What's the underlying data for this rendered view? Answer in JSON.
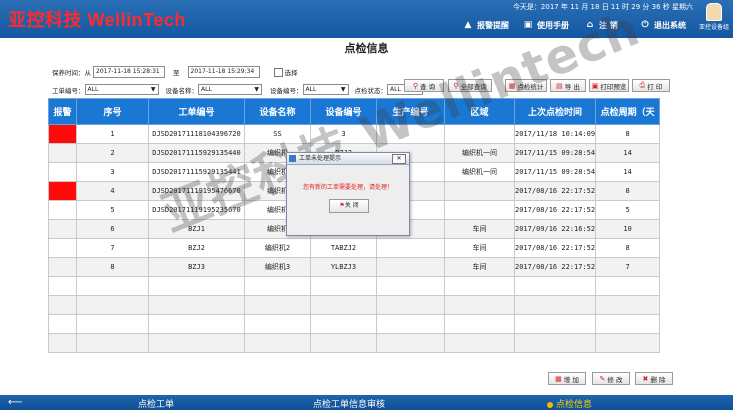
{
  "header": {
    "logo_text": "亚控科技 WellinTech",
    "datetime": "今天是：2017 年 11 月 18 日 11 时 29 分 36 秒   星期六",
    "nav": [
      {
        "label": "报警提醒",
        "icon": "bell-icon"
      },
      {
        "label": "使用手册",
        "icon": "book-icon"
      },
      {
        "label": "注 销",
        "icon": "home-icon"
      },
      {
        "label": "退出系统",
        "icon": "power-icon"
      }
    ],
    "user_label": "亚控设备组"
  },
  "page": {
    "title": "点检信息"
  },
  "filters": {
    "time_label": "保养时间：从",
    "time_from": "2017-11-18 15:28:31",
    "time_to_label": "至",
    "time_to": "2017-11-18 15:29:34",
    "select_label": "选择",
    "work_no_label": "工单编号：",
    "work_no_value": "ALL",
    "device_name_label": "设备名称：",
    "device_name_value": "ALL",
    "device_no_label": "设备编号：",
    "device_no_value": "ALL",
    "check_status_label": "点检状态：",
    "check_status_value": "ALL"
  },
  "toolbar": {
    "query": "查 询",
    "query_all": "全部查询",
    "stats": "点检统计",
    "export": "导 出",
    "print_preview": "打印预览",
    "print": "打 印"
  },
  "table": {
    "columns": [
      "报警",
      "序号",
      "工单编号",
      "设备名称",
      "设备编号",
      "生产编号",
      "区域",
      "上次点检时间",
      "点检周期（天"
    ],
    "rows": [
      {
        "alarm": true,
        "no": "1",
        "work_no": "DJSD20171118104396720",
        "device_name": "SS",
        "device_no": "3",
        "prod_no": "",
        "area": "",
        "last_time": "2017/11/18 10:14:09",
        "cycle": "8"
      },
      {
        "alarm": false,
        "no": "2",
        "work_no": "DJSD20171115929135440",
        "device_name": "编织机",
        "device_no": "BZJ2",
        "prod_no": "",
        "area": "编织机一间",
        "last_time": "2017/11/15 09:28:54",
        "cycle": "14"
      },
      {
        "alarm": false,
        "no": "3",
        "work_no": "DJSD20171115929135441",
        "device_name": "编织机",
        "device_no": "",
        "prod_no": "",
        "area": "编织机一间",
        "last_time": "2017/11/15 09:28:54",
        "cycle": "14"
      },
      {
        "alarm": true,
        "no": "4",
        "work_no": "DJSD20171119195476670",
        "device_name": "编织机",
        "device_no": "",
        "prod_no": "",
        "area": "",
        "last_time": "2017/08/16 22:17:52",
        "cycle": "8"
      },
      {
        "alarm": false,
        "no": "5",
        "work_no": "DJSD20171119195235670",
        "device_name": "编织机",
        "device_no": "",
        "prod_no": "",
        "area": "",
        "last_time": "2017/08/16 22:17:52",
        "cycle": "5"
      },
      {
        "alarm": false,
        "no": "6",
        "work_no": "BZJ1",
        "device_name": "编织机",
        "device_no": "",
        "prod_no": "",
        "area": "车间",
        "last_time": "2017/09/16 22:16:52",
        "cycle": "10"
      },
      {
        "alarm": false,
        "no": "7",
        "work_no": "BZJ2",
        "device_name": "编织机2",
        "device_no": "TABZJ2",
        "prod_no": "",
        "area": "车间",
        "last_time": "2017/08/16 22:17:52",
        "cycle": "8"
      },
      {
        "alarm": false,
        "no": "8",
        "work_no": "BZJ3",
        "device_name": "编织机3",
        "device_no": "YLBZJ3",
        "prod_no": "",
        "area": "车间",
        "last_time": "2017/08/16 22:17:52",
        "cycle": "7"
      },
      {
        "alarm": false,
        "no": "",
        "work_no": "",
        "device_name": "",
        "device_no": "",
        "prod_no": "",
        "area": "",
        "last_time": "",
        "cycle": ""
      },
      {
        "alarm": false,
        "no": "",
        "work_no": "",
        "device_name": "",
        "device_no": "",
        "prod_no": "",
        "area": "",
        "last_time": "",
        "cycle": ""
      },
      {
        "alarm": false,
        "no": "",
        "work_no": "",
        "device_name": "",
        "device_no": "",
        "prod_no": "",
        "area": "",
        "last_time": "",
        "cycle": ""
      },
      {
        "alarm": false,
        "no": "",
        "work_no": "",
        "device_name": "",
        "device_no": "",
        "prod_no": "",
        "area": "",
        "last_time": "",
        "cycle": ""
      }
    ]
  },
  "dialog": {
    "title": "工单未处理提示",
    "close_x": "✕",
    "message": "您有新的工单需要处理，请处理！",
    "button": "关 闭"
  },
  "bottom_buttons": {
    "add": "增 加",
    "edit": "修 改",
    "delete": "删 除"
  },
  "watermark": {
    "text": "亚控科技 Wellintech"
  },
  "footer": {
    "back_icon": "back-arrow-icon",
    "tabs": [
      "点检工单",
      "点检工单信息审核",
      "点检信息"
    ]
  },
  "colors": {
    "header_blue": "#1457a2",
    "table_header": "#1a78d4",
    "alarm_red": "#ff0a0a",
    "logo_red": "#ff2a2a",
    "active_tab": "#ffd200"
  }
}
